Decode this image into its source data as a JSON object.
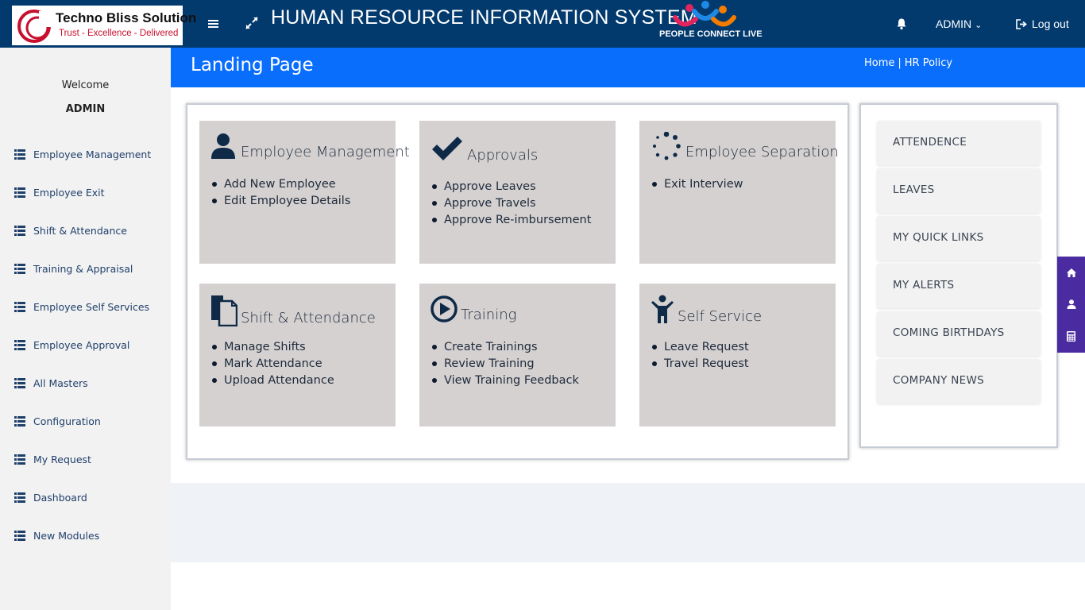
{
  "header": {
    "logo_title": "Techno Bliss Solution",
    "logo_tagline": "Trust - Excellence - Delivered",
    "app_title": "HUMAN RESOURCE INFORMATION SYSTEM",
    "partner_logo_text": "PEOPLE CONNECT LIVE",
    "user_menu_label": "ADMIN",
    "logout_label": "Log out",
    "icons": [
      "menu-icon",
      "expand-icon",
      "bell-icon",
      "chevron-down-icon",
      "logout-icon"
    ],
    "bg_color": "#023a6e"
  },
  "sidebar": {
    "welcome": "Welcome",
    "user": "ADMIN",
    "items": [
      {
        "label": "Employee Management"
      },
      {
        "label": "Employee Exit"
      },
      {
        "label": "Shift & Attendance"
      },
      {
        "label": "Training & Appraisal"
      },
      {
        "label": "Employee Self Services"
      },
      {
        "label": "Employee Approval"
      },
      {
        "label": "All Masters"
      },
      {
        "label": "Configuration"
      },
      {
        "label": "My Request"
      },
      {
        "label": "Dashboard"
      },
      {
        "label": "New Modules"
      }
    ]
  },
  "page": {
    "title": "Landing Page",
    "breadcrumb": [
      "Home",
      "HR Policy"
    ],
    "band_color": "#0a6efd"
  },
  "tiles": [
    {
      "title": "Employee Management",
      "icon": "user-icon",
      "links": [
        "Add New Employee",
        "Edit Employee Details"
      ]
    },
    {
      "title": "Approvals",
      "icon": "check-icon",
      "links": [
        "Approve Leaves",
        "Approve Travels",
        "Approve Re-imbursement"
      ]
    },
    {
      "title": "Employee Separation",
      "icon": "spinner-icon",
      "links": [
        "Exit Interview"
      ]
    },
    {
      "title": "Shift & Attendance",
      "icon": "documents-icon",
      "links": [
        "Manage Shifts",
        "Mark Attendance",
        "Upload Attendance"
      ]
    },
    {
      "title": "Training",
      "icon": "play-circle-icon",
      "links": [
        "Create Trainings",
        "Review Training",
        "View Training Feedback"
      ]
    },
    {
      "title": "Self Service",
      "icon": "child-icon",
      "links": [
        "Leave Request",
        "Travel Request"
      ]
    }
  ],
  "quick_panel": {
    "items": [
      "ATTENDENCE",
      "LEAVES",
      "MY QUICK LINKS",
      "MY ALERTS",
      "COMING BIRTHDAYS",
      "COMPANY NEWS"
    ]
  },
  "float_tools": [
    "home-icon",
    "user-icon",
    "calculator-icon"
  ],
  "colors": {
    "tile_bg": "#d5d1d1",
    "float_strip": "#4b2ca0",
    "nav_text": "#1f3f6b"
  }
}
